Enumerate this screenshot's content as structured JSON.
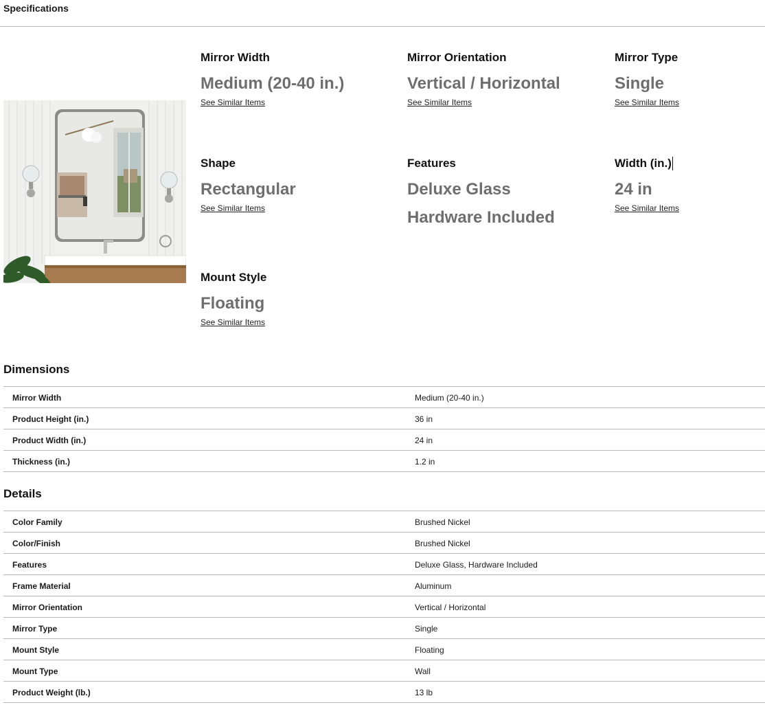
{
  "specifications": {
    "title": "Specifications"
  },
  "attributes": [
    {
      "title": "Mirror Width",
      "values": [
        "Medium (20-40 in.)"
      ],
      "link": "See Similar Items"
    },
    {
      "title": "Mirror Orientation",
      "values": [
        "Vertical / Horizontal"
      ],
      "link": "See Similar Items"
    },
    {
      "title": "Mirror Type",
      "values": [
        "Single"
      ],
      "link": "See Similar Items"
    },
    {
      "title": "Shape",
      "values": [
        "Rectangular"
      ],
      "link": "See Similar Items"
    },
    {
      "title": "Features",
      "values": [
        "Deluxe Glass",
        "Hardware Included"
      ],
      "link": ""
    },
    {
      "title": "Width (in.)",
      "values": [
        "24 in"
      ],
      "link": "See Similar Items"
    },
    {
      "title": "Mount Style",
      "values": [
        "Floating"
      ],
      "link": "See Similar Items"
    }
  ],
  "dimensions": {
    "title": "Dimensions",
    "rows": [
      {
        "label": "Mirror Width",
        "value": "Medium (20-40 in.)"
      },
      {
        "label": "Product Height (in.)",
        "value": "36 in"
      },
      {
        "label": "Product Width (in.)",
        "value": "24 in"
      },
      {
        "label": "Thickness (in.)",
        "value": "1.2 in"
      }
    ]
  },
  "details": {
    "title": "Details",
    "rows": [
      {
        "label": "Color Family",
        "value": "Brushed Nickel"
      },
      {
        "label": "Color/Finish",
        "value": "Brushed Nickel"
      },
      {
        "label": "Features",
        "value": "Deluxe Glass, Hardware Included"
      },
      {
        "label": "Frame Material",
        "value": "Aluminum"
      },
      {
        "label": "Mirror Orientation",
        "value": "Vertical / Horizontal"
      },
      {
        "label": "Mirror Type",
        "value": "Single"
      },
      {
        "label": "Mount Style",
        "value": "Floating"
      },
      {
        "label": "Mount Type",
        "value": "Wall"
      },
      {
        "label": "Product Weight (lb.)",
        "value": "13 lb"
      }
    ]
  },
  "colors": {
    "value_text": "#6e6e6e",
    "divider": "#b8b8b8"
  }
}
